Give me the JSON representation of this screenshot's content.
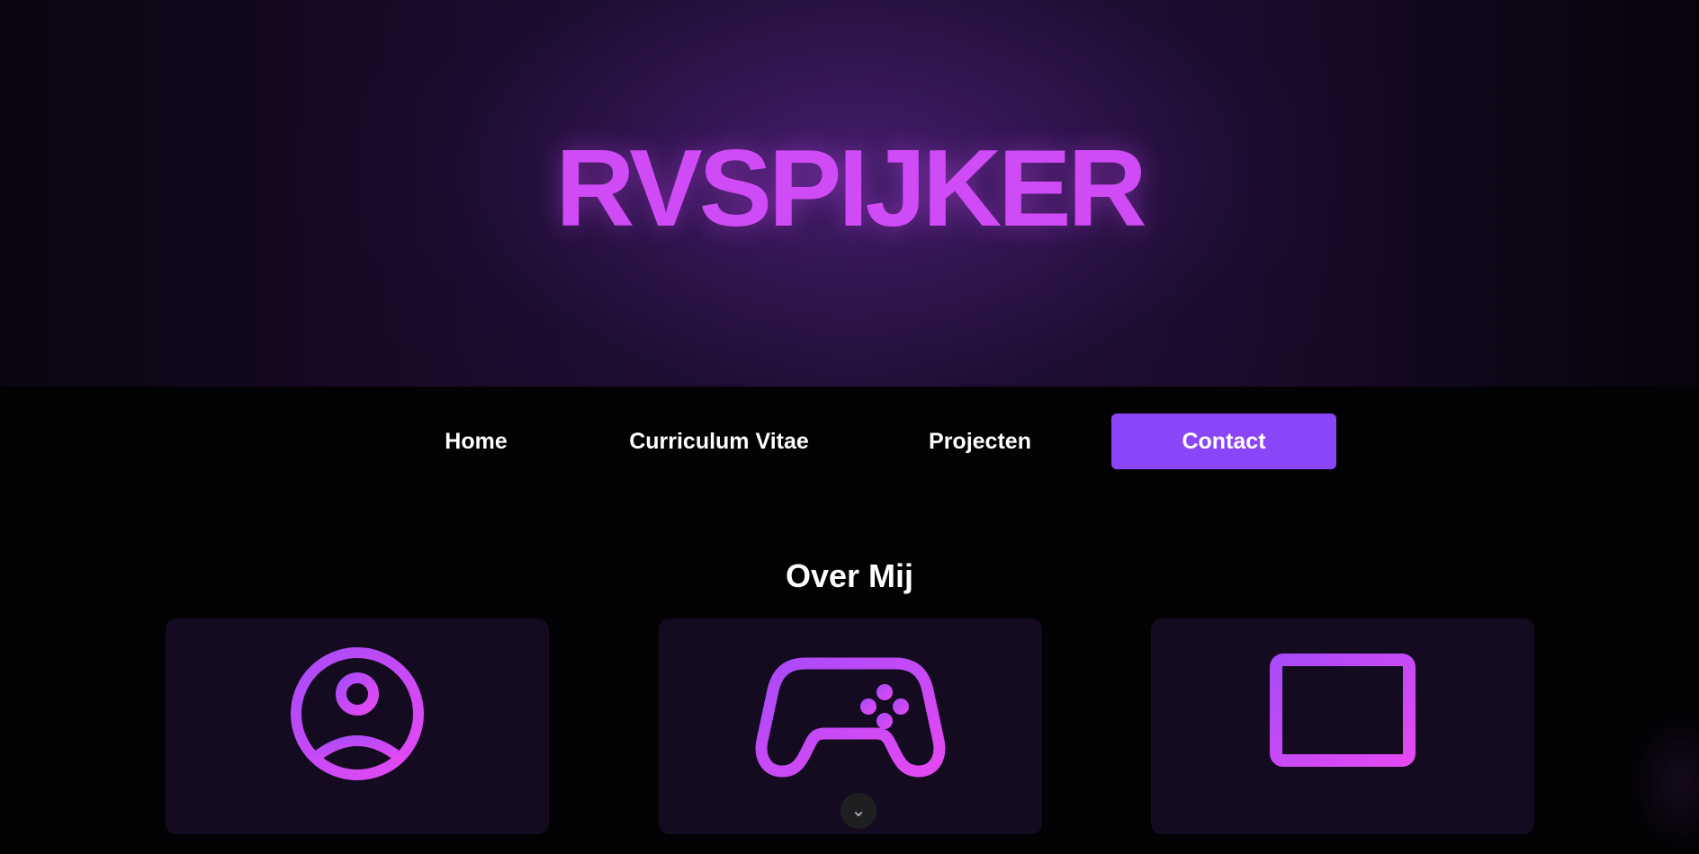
{
  "hero": {
    "title": "RVSPIJKER"
  },
  "nav": {
    "items": [
      {
        "label": "Home"
      },
      {
        "label": "Curriculum Vitae"
      },
      {
        "label": "Projecten"
      },
      {
        "label": "Contact",
        "active": true
      }
    ]
  },
  "about": {
    "title": "Over Mij",
    "cards": [
      {
        "icon": "user-circle-icon"
      },
      {
        "icon": "gamepad-icon"
      },
      {
        "icon": "laptop-icon"
      }
    ]
  },
  "scroll_button": {
    "glyph": "⌄"
  },
  "colors": {
    "accent": "#cf4bf5",
    "button": "#8b45f8",
    "gradient_start": "#b44af9",
    "gradient_end": "#e048f3",
    "background": "#020103",
    "card": "#140b20"
  }
}
